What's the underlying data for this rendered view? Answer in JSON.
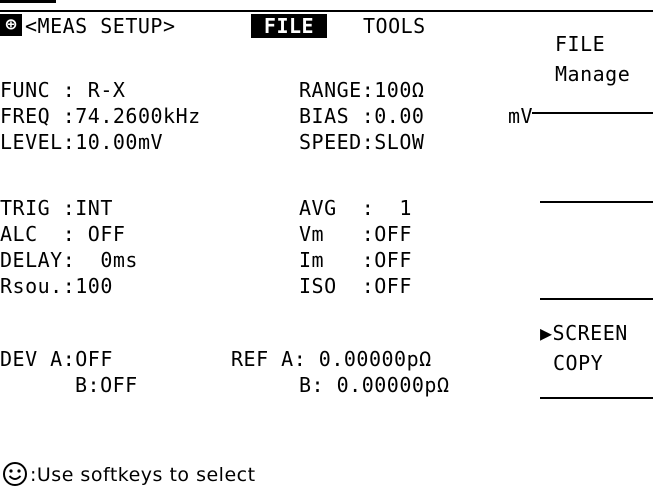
{
  "header": {
    "meas_setup_tab": "<MEAS SETUP>",
    "file_tab": "FILE",
    "tools_tab": "TOOLS"
  },
  "params": {
    "func": "FUNC : R-X",
    "freq": "FREQ :74.2600kHz",
    "level": "LEVEL:10.00mV",
    "range": "RANGE:100Ω",
    "bias": "BIAS :0.00",
    "bias_unit": "mV",
    "speed": "SPEED:SLOW",
    "trig": "TRIG :INT",
    "alc": "ALC  : OFF",
    "delay": "DELAY:  0ms",
    "rsou": "Rsou.:100",
    "avg": "AVG  :  1",
    "vm": "Vm   :OFF",
    "im": "Im   :OFF",
    "iso": "ISO  :OFF",
    "dev_a": "DEV A:OFF",
    "dev_b": "B:OFF",
    "ref_a": "REF A: 0.00000pΩ",
    "ref_b": "B: 0.00000pΩ"
  },
  "softkeys": {
    "file_manage_line1": "FILE",
    "file_manage_line2": "Manage",
    "screen_copy_line1": "▶SCREEN",
    "screen_copy_line2": "COPY"
  },
  "status": {
    "hint": ":Use softkeys to select"
  },
  "icons": {
    "menu_icon": "toggle-icon",
    "status_icon": "smiley-icon"
  }
}
